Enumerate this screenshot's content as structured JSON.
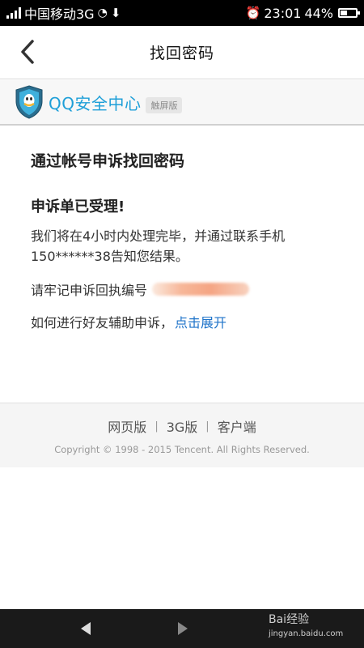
{
  "status_bar": {
    "carrier": "中国移动3G",
    "time": "23:01",
    "battery": "44%",
    "battery_level": 0.44
  },
  "app_bar": {
    "title": "找回密码",
    "back_icon": "chevron-left-icon"
  },
  "brand": {
    "name": "QQ安全中心",
    "tag": "触屏版",
    "logo_icon": "qq-shield-icon",
    "accent": "#1e9fd8"
  },
  "content": {
    "heading": "通过帐号申诉找回密码",
    "status": "申诉单已受理!",
    "message": "我们将在4小时内处理完毕，并通过联系手机150******38告知您结果。",
    "receipt_label": "请牢记申诉回执编号",
    "friend_help_text": "如何进行好友辅助申诉，",
    "expand_link": "点击展开",
    "link_color": "#1e73c9"
  },
  "footer": {
    "links": [
      "网页版",
      "3G版",
      "客户端"
    ],
    "separator": "|",
    "copyright": "Copyright © 1998 - 2015 Tencent. All Rights Reserved."
  },
  "nav_bar": {
    "watermark": "Bai经验",
    "watermark_sub": "jingyan.baidu.com"
  }
}
